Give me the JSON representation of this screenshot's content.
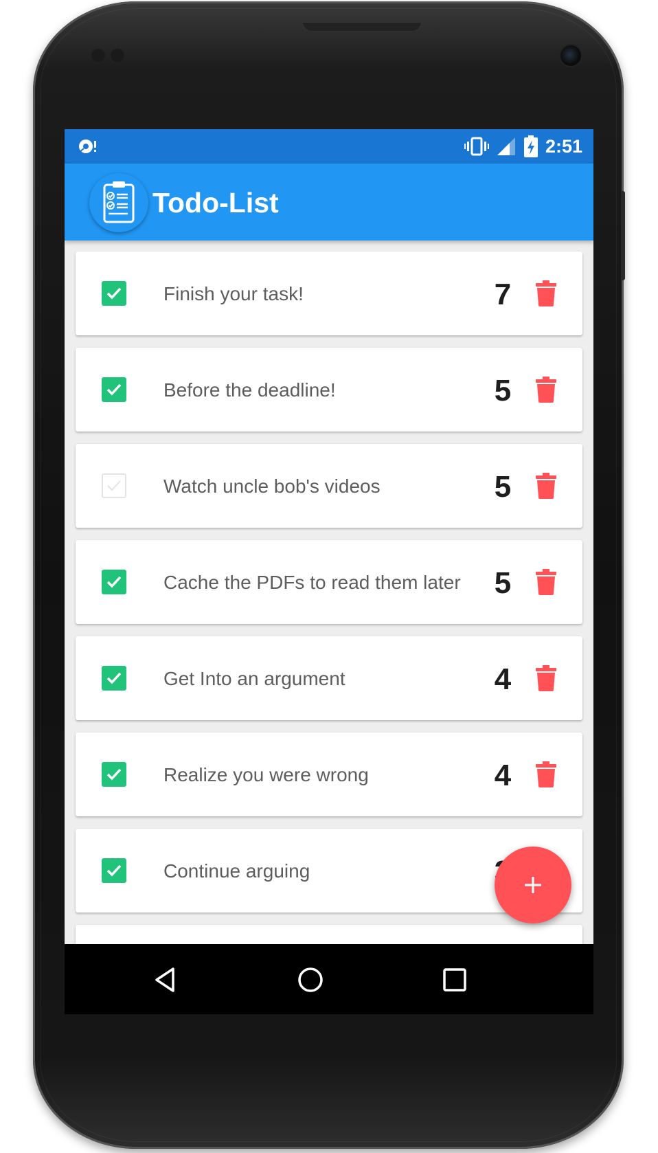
{
  "status_bar": {
    "time": "2:51",
    "icons": [
      "notification-icon",
      "vibrate-icon",
      "signal-icon",
      "battery-charging-icon"
    ]
  },
  "app_bar": {
    "title": "Todo-List",
    "icon": "clipboard-checklist-icon"
  },
  "tasks": [
    {
      "text": "Finish your task!",
      "priority": "7",
      "done": true
    },
    {
      "text": "Before the deadline!",
      "priority": "5",
      "done": true
    },
    {
      "text": "Watch uncle bob's videos",
      "priority": "5",
      "done": false
    },
    {
      "text": "Cache the PDFs to read them later",
      "priority": "5",
      "done": true
    },
    {
      "text": "Get Into an argument",
      "priority": "4",
      "done": true
    },
    {
      "text": "Realize you were wrong",
      "priority": "4",
      "done": true
    },
    {
      "text": "Continue arguing",
      "priority": "3",
      "done": true
    }
  ],
  "fab": {
    "label": "+",
    "icon": "add-icon"
  },
  "nav_bar": {
    "icons": [
      "back-icon",
      "home-icon",
      "recents-icon"
    ]
  },
  "colors": {
    "status_bar": "#1976d2",
    "app_bar": "#2196f3",
    "checkbox_checked": "#21c27a",
    "delete": "#ff5156",
    "fab": "#ff5156"
  }
}
